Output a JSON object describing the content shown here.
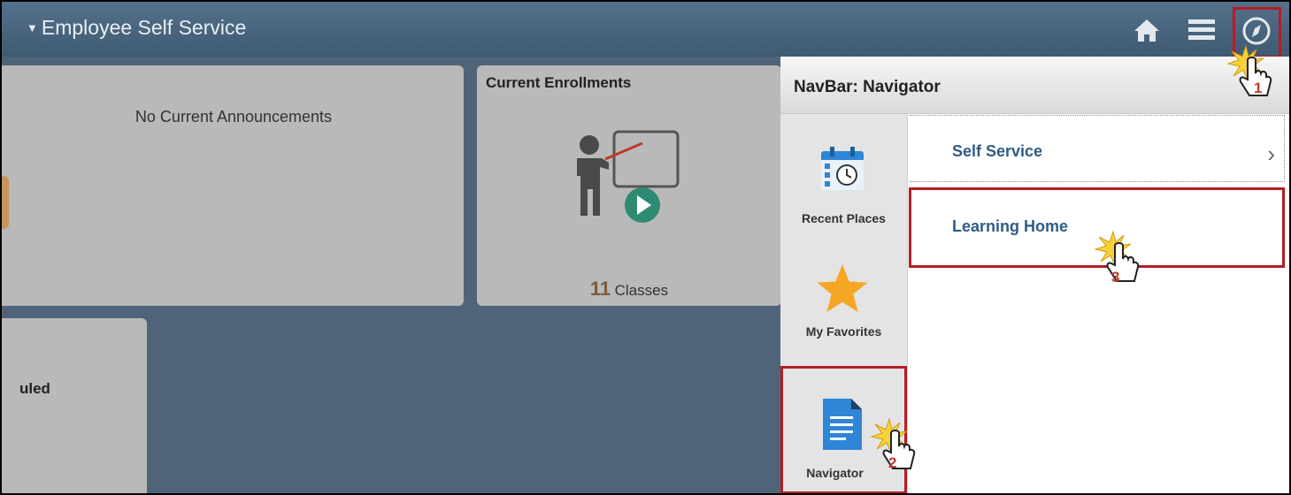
{
  "header": {
    "title": "Employee Self Service",
    "icons": [
      "home-icon",
      "menu-icon",
      "navbar-compass-icon"
    ]
  },
  "tiles": {
    "announcements": {
      "text": "No Current Announcements"
    },
    "enrollments": {
      "title": "Current Enrollments",
      "count": "11",
      "count_label": "Classes"
    },
    "partial": {
      "title_fragment": "uled"
    }
  },
  "navbar": {
    "title": "NavBar: Navigator",
    "side_items": [
      {
        "label": "Recent Places",
        "icon": "calendar-clock-icon"
      },
      {
        "label": "My Favorites",
        "icon": "star-icon"
      },
      {
        "label": "Navigator",
        "icon": "document-icon"
      }
    ],
    "list_items": [
      {
        "label": "Self Service",
        "has_chevron": true
      },
      {
        "label": "Learning Home",
        "has_chevron": false
      }
    ]
  },
  "callouts": [
    "1",
    "2",
    "3"
  ],
  "colors": {
    "header": "#4a657e",
    "background": "#4f6478",
    "tile": "#b9b9b9",
    "highlight": "#b21e24",
    "link": "#2f5b86",
    "star": "#f5a623",
    "document": "#2f86d6"
  }
}
